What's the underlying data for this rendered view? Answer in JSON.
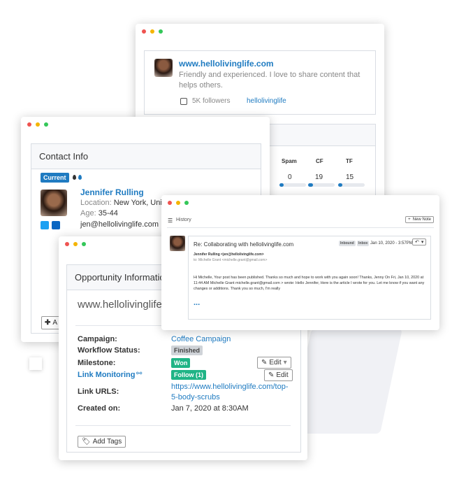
{
  "profile_window": {
    "site": "www.hellolivinglife.com",
    "bio": "Friendly and experienced. I love to share content that helps others.",
    "followers": "5K followers",
    "handle": "hellolivinglife",
    "metrics": [
      {
        "label": "Spam",
        "value": "0",
        "level": 0.15
      },
      {
        "label": "CF",
        "value": "19",
        "level": 0.19
      },
      {
        "label": "TF",
        "value": "15",
        "level": 0.15
      }
    ]
  },
  "contact_window": {
    "title": "Contact Info",
    "status_badge": "Current",
    "name": "Jennifer Rulling",
    "location_label": "Location:",
    "location_value": "New York, United",
    "age_label": "Age:",
    "age_value": "35-44",
    "email": "jen@hellolivinglife.com",
    "add_label": "A"
  },
  "history_window": {
    "title": "History",
    "new_note": "New Note",
    "subject": "Re: Collaborating with hellolivinglife.com",
    "tags": [
      "Inbound",
      "Inbox"
    ],
    "date": "Jan 10, 2020 - 3:57PM",
    "from": "Jennifer Rulling <jen@hellolivinglife.com>",
    "to": "to: Michelle Grant <michelle.grant@gmail.com>",
    "body": "Hi Michelle, Your post has been published. Thanks so much and hope to work with you again soon! Thanks, Jenny On Fri, Jan 10, 2020 at 11:44 AM Michelle Grant michelle.grant@gmail.com > wrote: Hello Jennifer, Here is the article I wrote for you. Let me know if you want any changes or additions. Thank you so much, I'm really",
    "more": "..."
  },
  "opportunity_window": {
    "title": "Opportunity Information",
    "site": "www.hellolivinglife.",
    "campaign_label": "Campaign:",
    "campaign_value": "Coffee Campaign",
    "workflow_label": "Workflow Status:",
    "workflow_value": "Finished",
    "milestone_label": "Milestone:",
    "milestone_value": "Won",
    "edit_label": "Edit",
    "link_monitoring_label": "Link Monitoring",
    "link_monitoring_value": "Follow (1)",
    "link_urls_label": "Link URLS:",
    "link_urls_value_1": "https://www.hellolivinglife.com/top-",
    "link_urls_value_2": "5-body-scrubs",
    "created_label": "Created on:",
    "created_value": "Jan 7, 2020 at 8:30AM",
    "add_tags": "Add Tags"
  },
  "colors": {
    "link": "#1f7bc1",
    "won": "#20b486",
    "finished": "#cfd3d8",
    "current": "#1f7bc1"
  }
}
